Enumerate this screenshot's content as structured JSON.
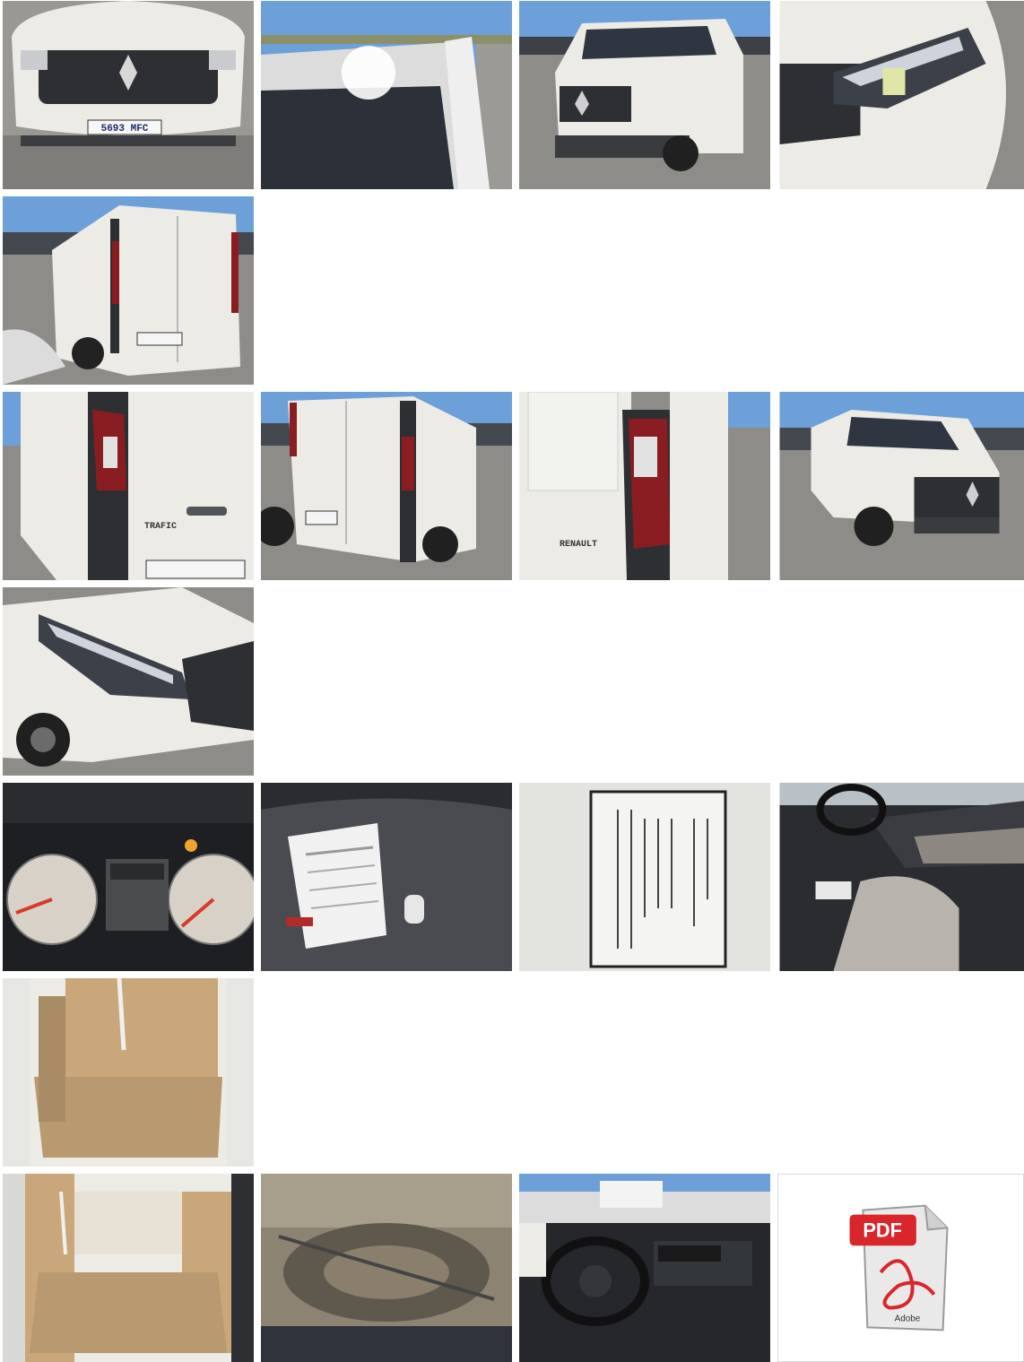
{
  "gallery": {
    "photos": [
      {
        "id": "front-view",
        "plate": "5693 MFC"
      },
      {
        "id": "roof-windshield"
      },
      {
        "id": "front-three-quarter"
      },
      {
        "id": "headlight-closeup"
      },
      {
        "id": "rear-three-quarter"
      },
      {
        "id": "rear-side-trafic",
        "badge": "TRAFIC"
      },
      {
        "id": "rear-doors"
      },
      {
        "id": "rear-taillight-renault",
        "badge": "RENAULT"
      },
      {
        "id": "front-right-three-quarter"
      },
      {
        "id": "front-fender-closeup"
      },
      {
        "id": "instrument-cluster"
      },
      {
        "id": "documents-and-key"
      },
      {
        "id": "vin-label"
      },
      {
        "id": "cab-interior-passenger"
      },
      {
        "id": "cargo-area-side"
      },
      {
        "id": "cargo-area-rear"
      },
      {
        "id": "spare-tire"
      },
      {
        "id": "dashboard-steering"
      }
    ],
    "pdf": {
      "label": "PDF",
      "brand": "Adobe"
    }
  },
  "colors": {
    "sky": "#6d9fd8",
    "van_white": "#ecebe6",
    "asphalt": "#8e8c88",
    "pdf_red": "#d8262a"
  }
}
